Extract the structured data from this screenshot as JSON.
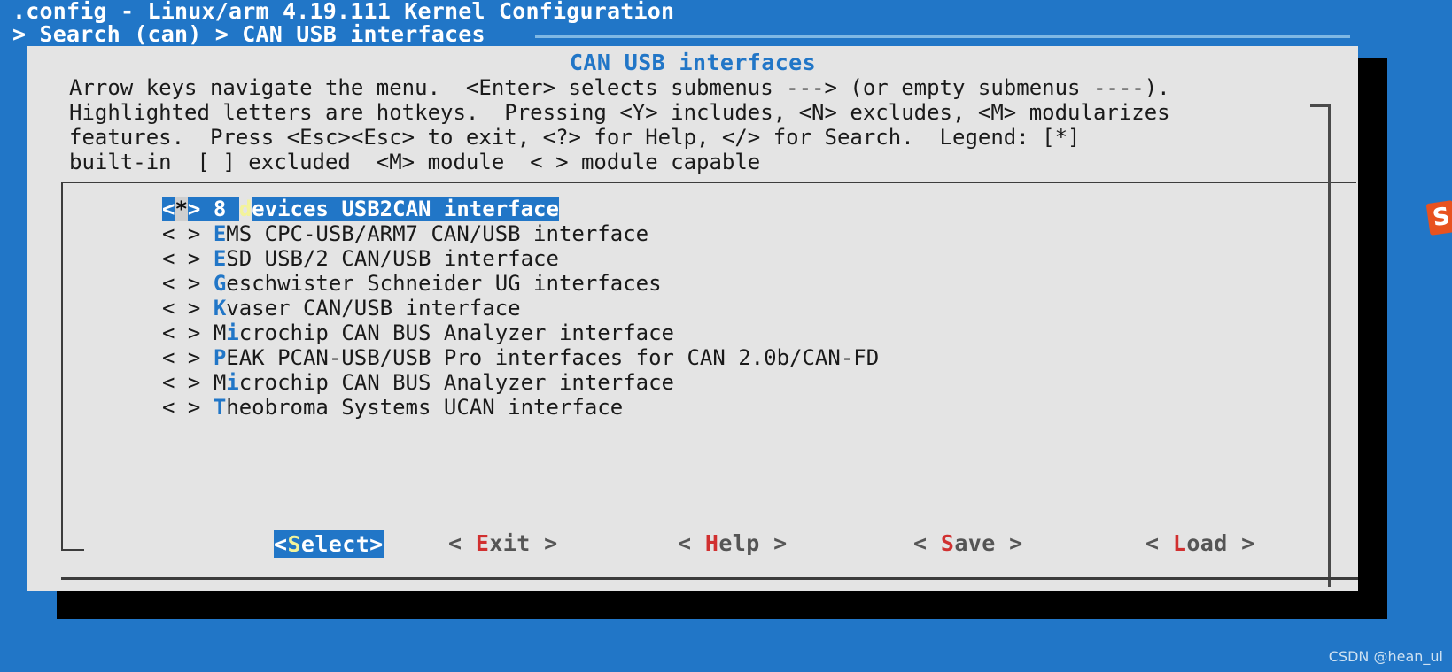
{
  "terminal": {
    "title": ".config - Linux/arm 4.19.111 Kernel Configuration",
    "breadcrumb": "> Search (can) > CAN USB interfaces",
    "bg_color": "#2176c7",
    "text_color": "#ffffff"
  },
  "dialog": {
    "title": "CAN USB interfaces",
    "title_color": "#2176c7",
    "bg_color": "#e4e4e4",
    "help_lines": [
      "Arrow keys navigate the menu.  <Enter> selects submenus ---> (or empty submenus ----).",
      "Highlighted letters are hotkeys.  Pressing <Y> includes, <N> excludes, <M> modularizes",
      "features.  Press <Esc><Esc> to exit, <?> for Help, </> for Search.  Legend: [*]",
      "built-in  [ ] excluded  <M> module  < > module capable"
    ]
  },
  "menu": {
    "selected_index": 0,
    "highlight_color": "#2176c7",
    "hotkey_color": "#2176c7",
    "selected_hotkey_color": "#f3f39a",
    "cursor_color": "#cfcfcf",
    "items": [
      {
        "marker": "<*>",
        "cursor_char": "*",
        "pre": "<",
        "post": ">",
        "pre_hot": "",
        "hot": "d",
        "label_before": "8 ",
        "label_after": "evices USB2CAN interface"
      },
      {
        "marker": "< >",
        "cursor_char": " ",
        "pre": "<",
        "post": ">",
        "pre_hot": "",
        "hot": "E",
        "label_before": "",
        "label_after": "MS CPC-USB/ARM7 CAN/USB interface"
      },
      {
        "marker": "< >",
        "cursor_char": " ",
        "pre": "<",
        "post": ">",
        "pre_hot": "",
        "hot": "E",
        "label_before": "",
        "label_after": "SD USB/2 CAN/USB interface"
      },
      {
        "marker": "< >",
        "cursor_char": " ",
        "pre": "<",
        "post": ">",
        "pre_hot": "",
        "hot": "G",
        "label_before": "",
        "label_after": "eschwister Schneider UG interfaces"
      },
      {
        "marker": "< >",
        "cursor_char": " ",
        "pre": "<",
        "post": ">",
        "pre_hot": "",
        "hot": "K",
        "label_before": "",
        "label_after": "vaser CAN/USB interface"
      },
      {
        "marker": "< >",
        "cursor_char": " ",
        "pre": "<",
        "post": ">",
        "pre_hot": "",
        "hot": "i",
        "label_before": "M",
        "label_after": "crochip CAN BUS Analyzer interface"
      },
      {
        "marker": "< >",
        "cursor_char": " ",
        "pre": "<",
        "post": ">",
        "pre_hot": "",
        "hot": "P",
        "label_before": "",
        "label_after": "EAK PCAN-USB/USB Pro interfaces for CAN 2.0b/CAN-FD"
      },
      {
        "marker": "< >",
        "cursor_char": " ",
        "pre": "<",
        "post": ">",
        "pre_hot": "",
        "hot": "i",
        "label_before": "M",
        "label_after": "crochip CAN BUS Analyzer interface"
      },
      {
        "marker": "< >",
        "cursor_char": " ",
        "pre": "<",
        "post": ">",
        "pre_hot": "",
        "hot": "T",
        "label_before": "",
        "label_after": "heobroma Systems UCAN interface"
      }
    ]
  },
  "buttons": {
    "active_index": 0,
    "hotkey_color": "#d13030",
    "items": [
      {
        "name": "select",
        "prefix": "<",
        "hot": "S",
        "before": "",
        "after": "elect",
        "suffix": ">",
        "active": true
      },
      {
        "name": "exit",
        "prefix": "< ",
        "hot": "E",
        "before": "",
        "after": "xit",
        "suffix": " >",
        "active": false
      },
      {
        "name": "help",
        "prefix": "< ",
        "hot": "H",
        "before": "",
        "after": "elp",
        "suffix": " >",
        "active": false
      },
      {
        "name": "save",
        "prefix": "< ",
        "hot": "S",
        "before": "",
        "after": "ave",
        "suffix": " >",
        "active": false
      },
      {
        "name": "load",
        "prefix": "< ",
        "hot": "L",
        "before": "",
        "after": "oad",
        "suffix": " >",
        "active": false
      }
    ]
  },
  "widget": {
    "letter": "S",
    "color": "#e8521f"
  },
  "watermark": {
    "text": "CSDN @hean_ui"
  }
}
